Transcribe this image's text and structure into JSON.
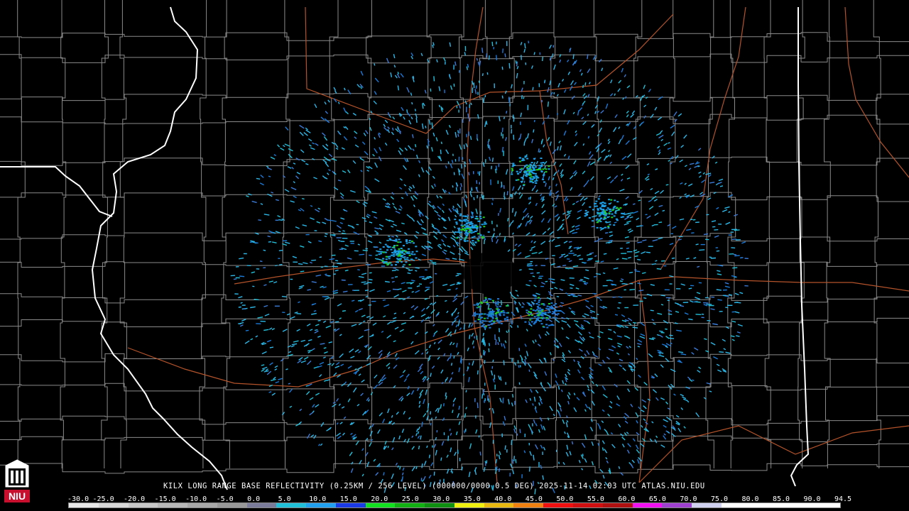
{
  "product": {
    "title": "KILX LONG RANGE BASE REFLECTIVITY (0.25KM / 256 LEVEL) (000000/0000 0.5 DEG) 2025-11-14 02:03 UTC  ATLAS.NIU.EDU"
  },
  "logo": {
    "text": "NIU",
    "color": "#c8102e"
  },
  "colors": {
    "background": "#000000",
    "county_lines": "#8a8a8a",
    "state_lines": "#ffffff",
    "rivers_highways": "#b4532a",
    "echo_primary": "#2ab8e8",
    "echo_secondary": "#3a7ad8"
  },
  "scale": {
    "labels": [
      "-30.0",
      "-25.0",
      "-20.0",
      "-15.0",
      "-10.0",
      "-5.0",
      "0.0",
      "5.0",
      "10.0",
      "15.0",
      "20.0",
      "25.0",
      "30.0",
      "35.0",
      "40.0",
      "45.0",
      "50.0",
      "55.0",
      "60.0",
      "65.0",
      "70.0",
      "75.0",
      "80.0",
      "85.0",
      "90.0",
      "94.5"
    ],
    "colors": [
      "#e8e8e8",
      "#d8d8d8",
      "#c8c8c8",
      "#b8b8b8",
      "#a8a8a8",
      "#989898",
      "#7a7a9a",
      "#20c0d8",
      "#22a0f0",
      "#1a3ae8",
      "#10e020",
      "#12b012",
      "#109010",
      "#f0f010",
      "#e8b810",
      "#f08010",
      "#f01010",
      "#d01010",
      "#b01010",
      "#f010f0",
      "#a040d0",
      "#d0d0f0",
      "#ffffff",
      "#ffffff",
      "#ffffff",
      "#ffffff"
    ]
  }
}
